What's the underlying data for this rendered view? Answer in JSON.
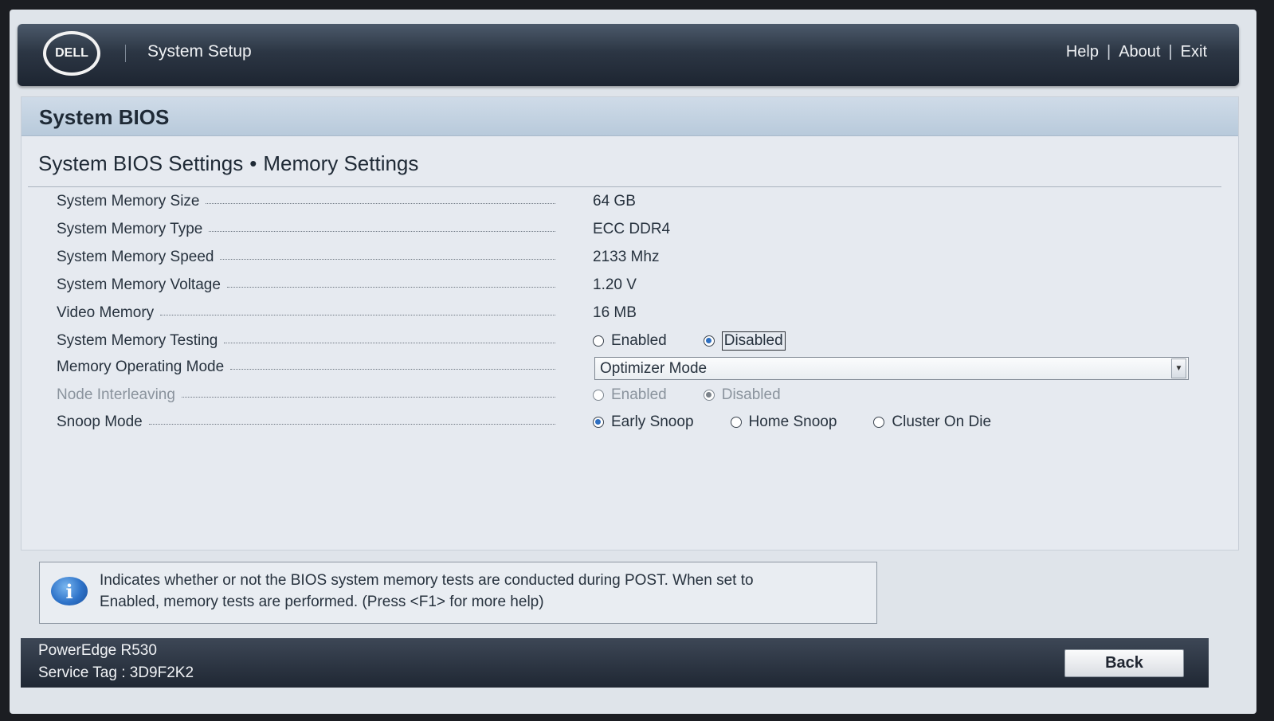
{
  "header": {
    "logo_text": "DELL",
    "app_title": "System Setup",
    "nav": {
      "help": "Help",
      "about": "About",
      "exit": "Exit",
      "separator": "|"
    }
  },
  "panel": {
    "title": "System BIOS",
    "breadcrumb": {
      "parent": "System BIOS Settings",
      "separator": "•",
      "current": "Memory Settings"
    }
  },
  "settings": {
    "memory_size": {
      "label": "System Memory Size",
      "value": "64 GB"
    },
    "memory_type": {
      "label": "System Memory Type",
      "value": "ECC DDR4"
    },
    "memory_speed": {
      "label": "System Memory Speed",
      "value": "2133 Mhz"
    },
    "memory_voltage": {
      "label": "System Memory Voltage",
      "value": "1.20 V"
    },
    "video_memory": {
      "label": "Video Memory",
      "value": "16 MB"
    },
    "memory_testing": {
      "label": "System Memory Testing",
      "options": [
        "Enabled",
        "Disabled"
      ],
      "selected": "Disabled"
    },
    "operating_mode": {
      "label": "Memory Operating Mode",
      "value": "Optimizer Mode"
    },
    "node_interleaving": {
      "label": "Node Interleaving",
      "options": [
        "Enabled",
        "Disabled"
      ],
      "selected": "Disabled",
      "disabled": true
    },
    "snoop_mode": {
      "label": "Snoop Mode",
      "options": [
        "Early Snoop",
        "Home Snoop",
        "Cluster On Die"
      ],
      "selected": "Early Snoop"
    }
  },
  "help": {
    "icon": "info-icon",
    "line1": "Indicates whether or not the BIOS system memory tests are conducted during POST. When set to",
    "line2": "Enabled, memory tests are performed. (Press <F1> for more help)"
  },
  "footer": {
    "model": "PowerEdge R530",
    "service_tag": "Service Tag : 3D9F2K2",
    "back_label": "Back"
  },
  "colors": {
    "header_bg": "#2c3644",
    "title_bar": "#c4d3e2",
    "panel_bg": "#e6eaf0",
    "radio_selected": "#2e6fc1"
  }
}
